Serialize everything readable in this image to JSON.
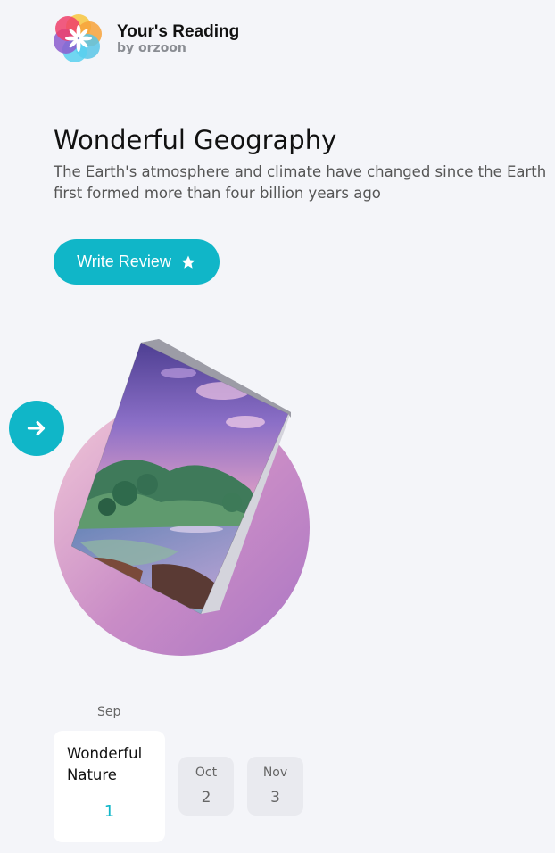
{
  "brand": {
    "name": "Your's Reading",
    "byline": "by orzoon",
    "logo_icon": "flower-logo-icon"
  },
  "book": {
    "title": "Wonderful Geography",
    "description": "The Earth's atmosphere and climate have changed since the Earth first formed more than four billion years ago",
    "cover_icon": "book-cover-image"
  },
  "actions": {
    "write_review_label": "Write Review",
    "write_review_icon": "star-icon",
    "next_icon": "arrow-right-icon"
  },
  "colors": {
    "accent": "#10b6c8",
    "background": "#f4f5f9",
    "circle_start": "#f2c9d8",
    "circle_end": "#ab76c4"
  },
  "timeline": {
    "current": {
      "month": "Sep",
      "title": "Wonderful Nature",
      "number": "1"
    },
    "upcoming": [
      {
        "month": "Oct",
        "number": "2"
      },
      {
        "month": "Nov",
        "number": "3"
      }
    ]
  }
}
